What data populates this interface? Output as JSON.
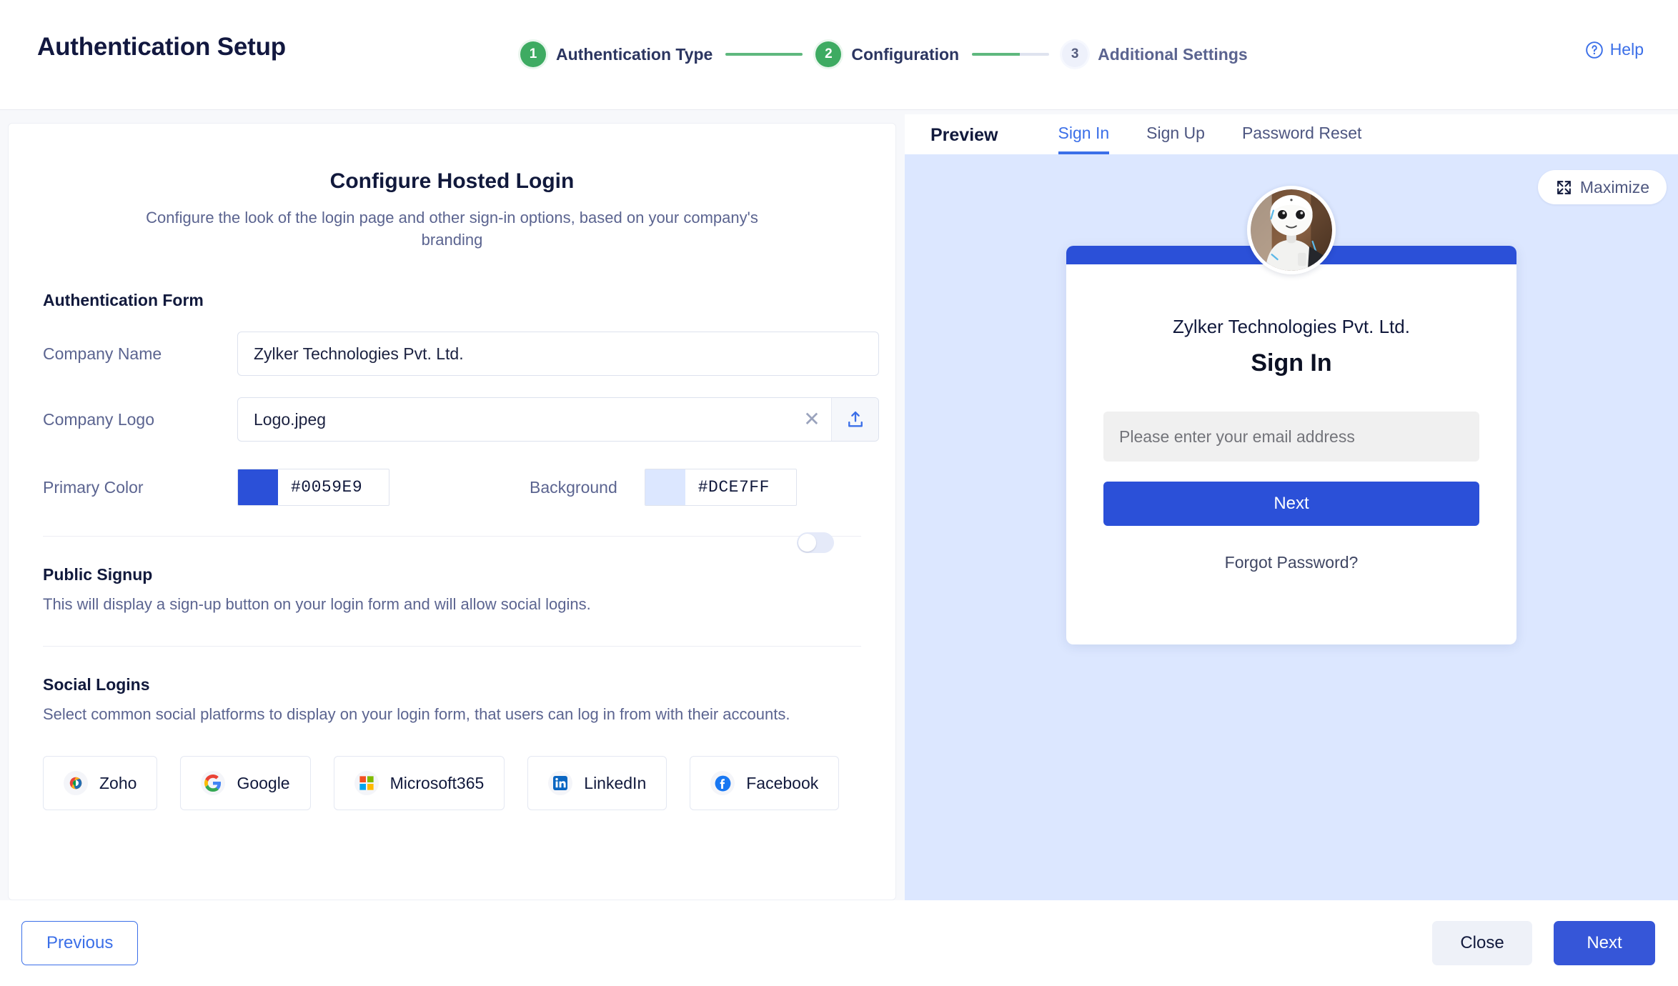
{
  "header": {
    "title": "Authentication Setup",
    "help_label": "Help",
    "help_icon": "question-circle-icon",
    "steps": [
      {
        "number": "1",
        "label": "Authentication Type",
        "state": "done"
      },
      {
        "number": "2",
        "label": "Configuration",
        "state": "done"
      },
      {
        "number": "3",
        "label": "Additional Settings",
        "state": "todo"
      }
    ]
  },
  "form": {
    "title": "Configure Hosted Login",
    "subtitle": "Configure the look of the login page and other sign-in options, based on your company's branding",
    "section_heading": "Authentication Form",
    "company_name": {
      "label": "Company Name",
      "value": "Zylker Technologies Pvt. Ltd."
    },
    "company_logo": {
      "label": "Company Logo",
      "value": "Logo.jpeg",
      "clear_icon": "close-icon",
      "upload_icon": "upload-icon"
    },
    "primary_color": {
      "label": "Primary Color",
      "value": "#0059E9",
      "swatch": "#2b50d8"
    },
    "background_color": {
      "label": "Background",
      "value": "#DCE7FF",
      "swatch": "#dce7ff"
    },
    "public_signup": {
      "heading": "Public Signup",
      "description": "This will display a sign-up button on your login form and will allow social logins.",
      "enabled": false
    },
    "social_logins": {
      "heading": "Social Logins",
      "description": "Select common social platforms to display on your login form, that users can log in from with their accounts.",
      "providers": [
        {
          "label": "Zoho",
          "icon": "zoho-icon"
        },
        {
          "label": "Google",
          "icon": "google-icon"
        },
        {
          "label": "Microsoft365",
          "icon": "microsoft-icon"
        },
        {
          "label": "LinkedIn",
          "icon": "linkedin-icon"
        },
        {
          "label": "Facebook",
          "icon": "facebook-icon"
        }
      ]
    }
  },
  "preview": {
    "title": "Preview",
    "tabs": [
      {
        "label": "Sign In",
        "active": true
      },
      {
        "label": "Sign Up",
        "active": false
      },
      {
        "label": "Password Reset",
        "active": false
      }
    ],
    "maximize_label": "Maximize",
    "maximize_icon": "expand-arrows-icon",
    "login_card": {
      "avatar_icon": "robot-avatar",
      "company": "Zylker Technologies Pvt. Ltd.",
      "heading": "Sign In",
      "email_placeholder": "Please enter your email address",
      "next_label": "Next",
      "forgot_label": "Forgot Password?"
    }
  },
  "footer": {
    "previous_label": "Previous",
    "close_label": "Close",
    "next_label": "Next"
  }
}
